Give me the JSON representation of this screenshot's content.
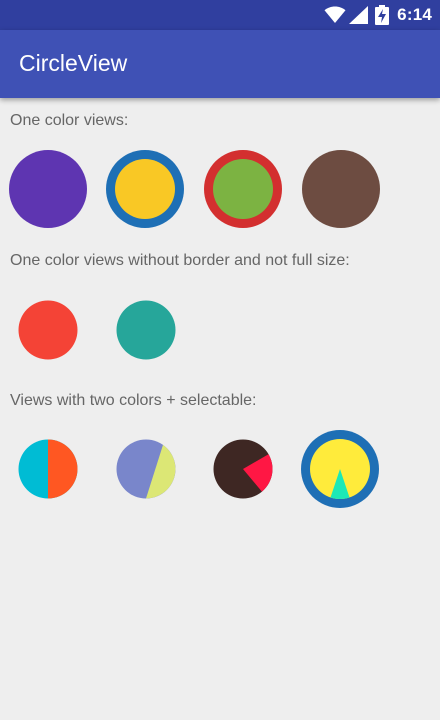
{
  "status_bar": {
    "time": "6:14",
    "icons": [
      "wifi-icon",
      "signal-icon",
      "battery-charging-icon"
    ]
  },
  "app_bar": {
    "title": "CircleView"
  },
  "sections": [
    {
      "label": "One color views:",
      "circles": [
        {
          "name": "purple-circle",
          "fill": "#5e35b1",
          "border_color": null
        },
        {
          "name": "yellow-circle-blue-border",
          "fill": "#f9c825",
          "border_color": "#1e6fb5"
        },
        {
          "name": "green-circle-red-border",
          "fill": "#7cb342",
          "border_color": "#d32f2f"
        },
        {
          "name": "brown-circle",
          "fill": "#6d4c41",
          "border_color": null
        }
      ]
    },
    {
      "label": "One color views without border and not full size:",
      "circles": [
        {
          "name": "red-circle",
          "fill": "#f44336"
        },
        {
          "name": "teal-circle",
          "fill": "#26a69a"
        }
      ]
    },
    {
      "label": "Views with two colors + selectable:",
      "circles": [
        {
          "name": "cyan-orange-circle",
          "colors": [
            "#00bcd4",
            "#ff5722"
          ],
          "selected": false
        },
        {
          "name": "indigo-lime-circle",
          "colors": [
            "#7986cb",
            "#dce775"
          ],
          "selected": false
        },
        {
          "name": "dark-pink-circle",
          "colors": [
            "#3e2723",
            "#ff1744"
          ],
          "selected": false
        },
        {
          "name": "yellow-turquoise-circle",
          "colors": [
            "#ffeb3b",
            "#1de9b6"
          ],
          "selected": true,
          "border_color": "#1e6fb5"
        }
      ]
    }
  ]
}
